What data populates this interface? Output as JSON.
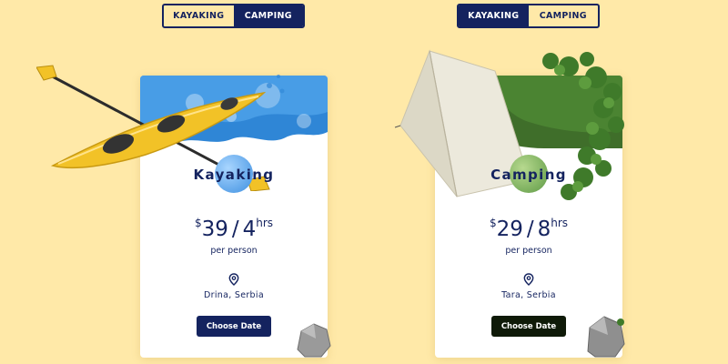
{
  "colors": {
    "background": "#ffe9a8",
    "navy": "#14235f",
    "dark_green": "#0f1a08",
    "water_blue": "#2f86d6",
    "grass_green": "#3f6e2a",
    "kayak_yellow": "#f2c227"
  },
  "toggles": [
    {
      "options": [
        {
          "label": "KAYAKING",
          "active": false
        },
        {
          "label": "CAMPING",
          "active": true
        }
      ]
    },
    {
      "options": [
        {
          "label": "KAYAKING",
          "active": true
        },
        {
          "label": "CAMPING",
          "active": false
        }
      ]
    }
  ],
  "cards": [
    {
      "title": "Kayaking",
      "currency": "$",
      "amount": "39",
      "separator": "/",
      "duration": "4",
      "duration_unit": "hrs",
      "per_label": "per person",
      "location_icon": "location-pin-icon",
      "location": "Drina, Serbia",
      "button_label": "Choose Date",
      "banner_image": "water-splash-image",
      "feature_image": "yellow-kayak-image"
    },
    {
      "title": "Camping",
      "currency": "$",
      "amount": "29",
      "separator": "/",
      "duration": "8",
      "duration_unit": "hrs",
      "per_label": "per person",
      "location_icon": "location-pin-icon",
      "location": "Tara, Serbia",
      "button_label": "Choose Date",
      "banner_image": "grass-hill-image",
      "feature_image": "white-tent-image"
    }
  ]
}
